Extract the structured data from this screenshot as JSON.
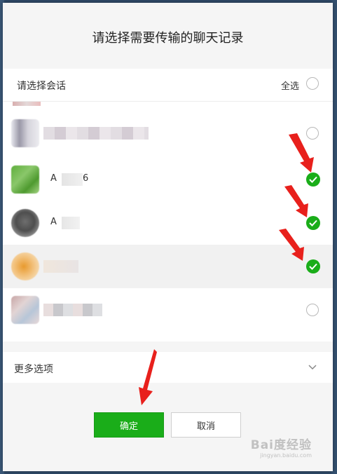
{
  "dialog": {
    "title": "请选择需要传输的聊天记录"
  },
  "list_header": {
    "label": "请选择会话",
    "select_all_label": "全选",
    "select_all_checked": false
  },
  "conversations": [
    {
      "name": "",
      "checked": false,
      "highlighted": false
    },
    {
      "name": "A",
      "name_suffix": "6",
      "checked": true,
      "highlighted": false
    },
    {
      "name": "A",
      "name_suffix": "",
      "checked": true,
      "highlighted": false
    },
    {
      "name": "",
      "checked": true,
      "highlighted": true
    },
    {
      "name": "",
      "checked": false,
      "highlighted": false
    }
  ],
  "more_options": {
    "label": "更多选项",
    "icon": "chevron-down-icon"
  },
  "buttons": {
    "confirm_label": "确定",
    "cancel_label": "取消"
  },
  "colors": {
    "accent_green": "#1aad19",
    "annotation_red": "#e8201c"
  },
  "watermark": {
    "text": "Bai度经验",
    "subtext": "jingyan.baidu.com"
  }
}
